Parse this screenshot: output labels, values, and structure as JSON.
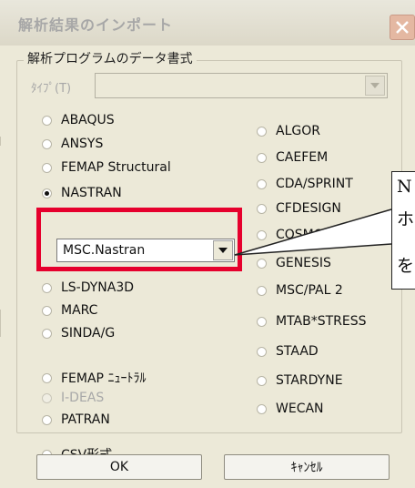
{
  "window": {
    "title": "解析結果のインポート"
  },
  "group": {
    "title": "解析プログラムのデータ書式",
    "type_label": "ﾀｲﾌﾟ(T)",
    "type_value": ""
  },
  "left_options": [
    {
      "label": "ABAQUS",
      "checked": false,
      "enabled": true
    },
    {
      "label": "ANSYS",
      "checked": false,
      "enabled": true
    },
    {
      "label": "FEMAP Structural",
      "checked": false,
      "enabled": true
    },
    {
      "label": "NASTRAN",
      "checked": true,
      "enabled": true
    },
    {
      "label": "LS-DYNA3D",
      "checked": false,
      "enabled": true
    },
    {
      "label": "MARC",
      "checked": false,
      "enabled": true
    },
    {
      "label": "SINDA/G",
      "checked": false,
      "enabled": true
    },
    {
      "label": "FEMAP ﾆｭｰﾄﾗﾙ",
      "checked": false,
      "enabled": true
    },
    {
      "label": "I-DEAS",
      "checked": false,
      "enabled": false
    },
    {
      "label": "PATRAN",
      "checked": false,
      "enabled": true
    },
    {
      "label": "CSV形式",
      "checked": false,
      "enabled": true
    }
  ],
  "right_options": [
    {
      "label": "ALGOR",
      "checked": false,
      "enabled": true
    },
    {
      "label": "CAEFEM",
      "checked": false,
      "enabled": true
    },
    {
      "label": "CDA/SPRINT",
      "checked": false,
      "enabled": true
    },
    {
      "label": "CFDESIGN",
      "checked": false,
      "enabled": true
    },
    {
      "label": "COSMOS",
      "checked": false,
      "enabled": true
    },
    {
      "label": "GENESIS",
      "checked": false,
      "enabled": true
    },
    {
      "label": "MSC/PAL 2",
      "checked": false,
      "enabled": true
    },
    {
      "label": "MTAB*STRESS",
      "checked": false,
      "enabled": true
    },
    {
      "label": "STAAD",
      "checked": false,
      "enabled": true
    },
    {
      "label": "STARDYNE",
      "checked": false,
      "enabled": true
    },
    {
      "label": "WECAN",
      "checked": false,
      "enabled": true
    }
  ],
  "nastran_variant": {
    "value": "MSC.Nastran"
  },
  "callout": {
    "line1": "N",
    "line2": "ホ",
    "line3": "を"
  },
  "buttons": {
    "ok": "OK",
    "cancel": "ｷｬﾝｾﾙ"
  },
  "colors": {
    "highlight": "#e6002d",
    "dialog_bg": "#ece9d8"
  }
}
